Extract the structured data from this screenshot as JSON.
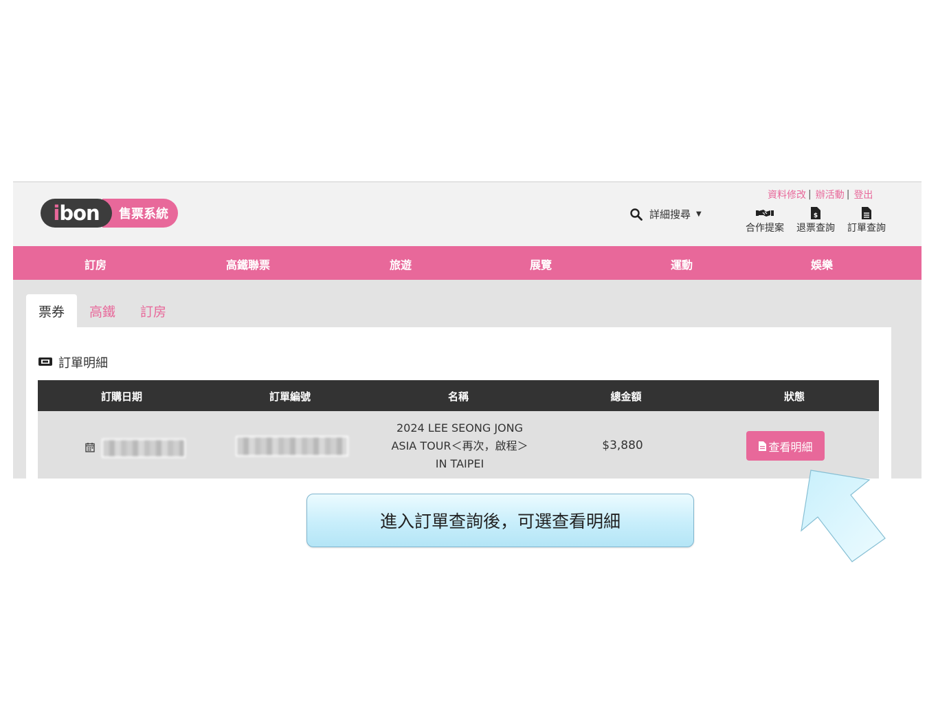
{
  "logo": {
    "brand": "bon",
    "brand_mark": "i",
    "sub": "售票系統"
  },
  "header": {
    "search_adv": "詳細搜尋",
    "top_links": [
      "資料修改",
      "辦活動",
      "登出"
    ],
    "quick": [
      {
        "label": "合作提案",
        "icon": "handshake-icon"
      },
      {
        "label": "退票查詢",
        "icon": "refund-doc-icon"
      },
      {
        "label": "訂單查詢",
        "icon": "order-doc-icon"
      }
    ]
  },
  "nav": [
    "訂房",
    "高鐵聯票",
    "旅遊",
    "展覽",
    "運動",
    "娛樂"
  ],
  "tabs": [
    "票券",
    "高鐵",
    "訂房"
  ],
  "section": {
    "title": "訂單明細"
  },
  "table": {
    "headers": [
      "訂購日期",
      "訂單編號",
      "名稱",
      "總金額",
      "狀態"
    ],
    "row": {
      "name_lines": [
        "2024 LEE SEONG JONG",
        "ASIA TOUR＜再次，啟程＞",
        "IN TAIPEI"
      ],
      "amount": "$3,880",
      "button": "查看明細"
    }
  },
  "callout": {
    "text": "進入訂單查詢後，可選查看明細"
  },
  "colors": {
    "accent": "#e8689a",
    "dark": "#333333",
    "callout": "#c8eefb"
  }
}
